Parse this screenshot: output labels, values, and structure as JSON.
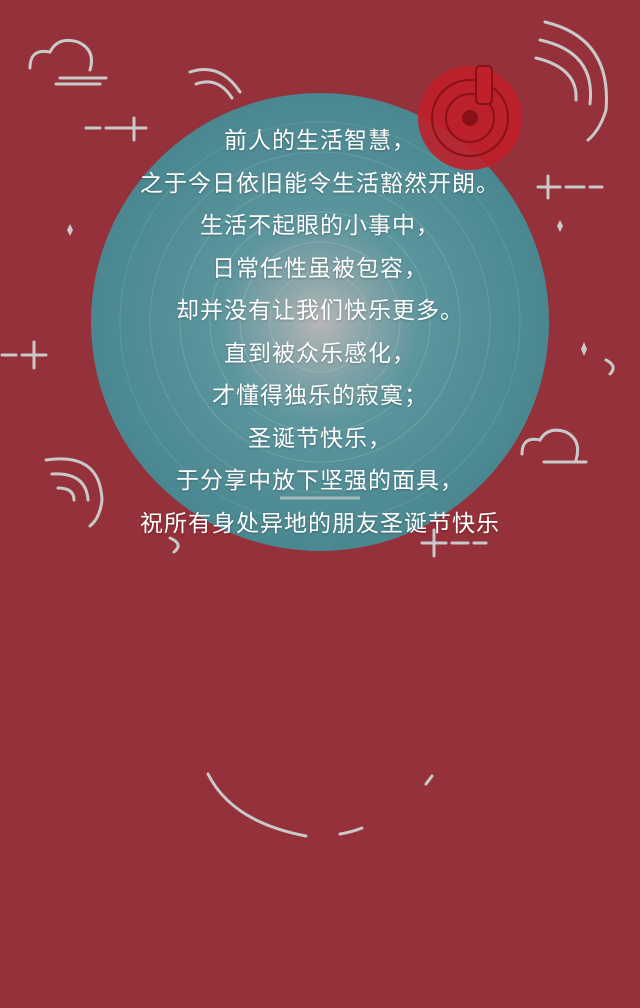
{
  "colors": {
    "background": "#94313a",
    "circle": "#4f8a93",
    "circle_center": "#9a9a9a",
    "text": "#ffffff",
    "ornament": "#c9c9c9"
  },
  "icons": [
    "cloud-icon",
    "sparkle-icon",
    "swirl-icon",
    "record-player-icon"
  ],
  "poem": {
    "lines": [
      "前人的生活智慧，",
      "之于今日依旧能令生活豁然开朗。",
      "生活不起眼的小事中，",
      "日常任性虽被包容，",
      "却并没有让我们快乐更多。",
      "直到被众乐感化，",
      "才懂得独乐的寂寞；",
      "圣诞节快乐，",
      "于分享中放下坚强的面具，",
      "祝所有身处异地的朋友圣诞节快乐"
    ]
  }
}
